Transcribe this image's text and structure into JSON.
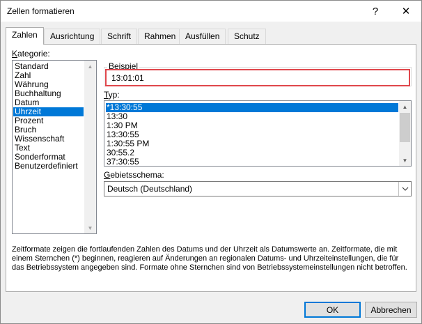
{
  "window": {
    "title": "Zellen formatieren",
    "help": "?",
    "close": "✕"
  },
  "tabs": [
    {
      "label": "Zahlen",
      "active": true
    },
    {
      "label": "Ausrichtung"
    },
    {
      "label": "Schrift"
    },
    {
      "label": "Rahmen"
    },
    {
      "label": "Ausfüllen"
    },
    {
      "label": "Schutz"
    }
  ],
  "category": {
    "label_first": "K",
    "label_rest": "ategorie:",
    "items": [
      "Standard",
      "Zahl",
      "Währung",
      "Buchhaltung",
      "Datum",
      "Uhrzeit",
      "Prozent",
      "Bruch",
      "Wissenschaft",
      "Text",
      "Sonderformat",
      "Benutzerdefiniert"
    ],
    "selected": "Uhrzeit"
  },
  "sample": {
    "label": "Beispiel",
    "value": "13:01:01"
  },
  "type": {
    "label_first": "T",
    "label_rest": "yp:",
    "items": [
      "*13:30:55",
      "13:30",
      "1:30 PM",
      "13:30:55",
      "1:30:55 PM",
      "30:55.2",
      "37:30:55"
    ],
    "selected": "*13:30:55"
  },
  "locale": {
    "label_first": "G",
    "label_rest": "ebietsschema:",
    "value": "Deutsch (Deutschland)"
  },
  "description": "Zeitformate zeigen die fortlaufenden Zahlen des Datums und der Uhrzeit als Datumswerte an. Zeitformate, die mit einem Sternchen (*) beginnen, reagieren auf Änderungen an regionalen Datums- und Uhrzeiteinstellungen, die für das Betriebssystem angegeben sind. Formate ohne Sternchen sind von Betriebssystemeinstellungen nicht betroffen.",
  "buttons": {
    "ok": "OK",
    "cancel": "Abbrechen"
  },
  "colors": {
    "selection": "#0078d7",
    "highlight_box": "#e0474c"
  }
}
